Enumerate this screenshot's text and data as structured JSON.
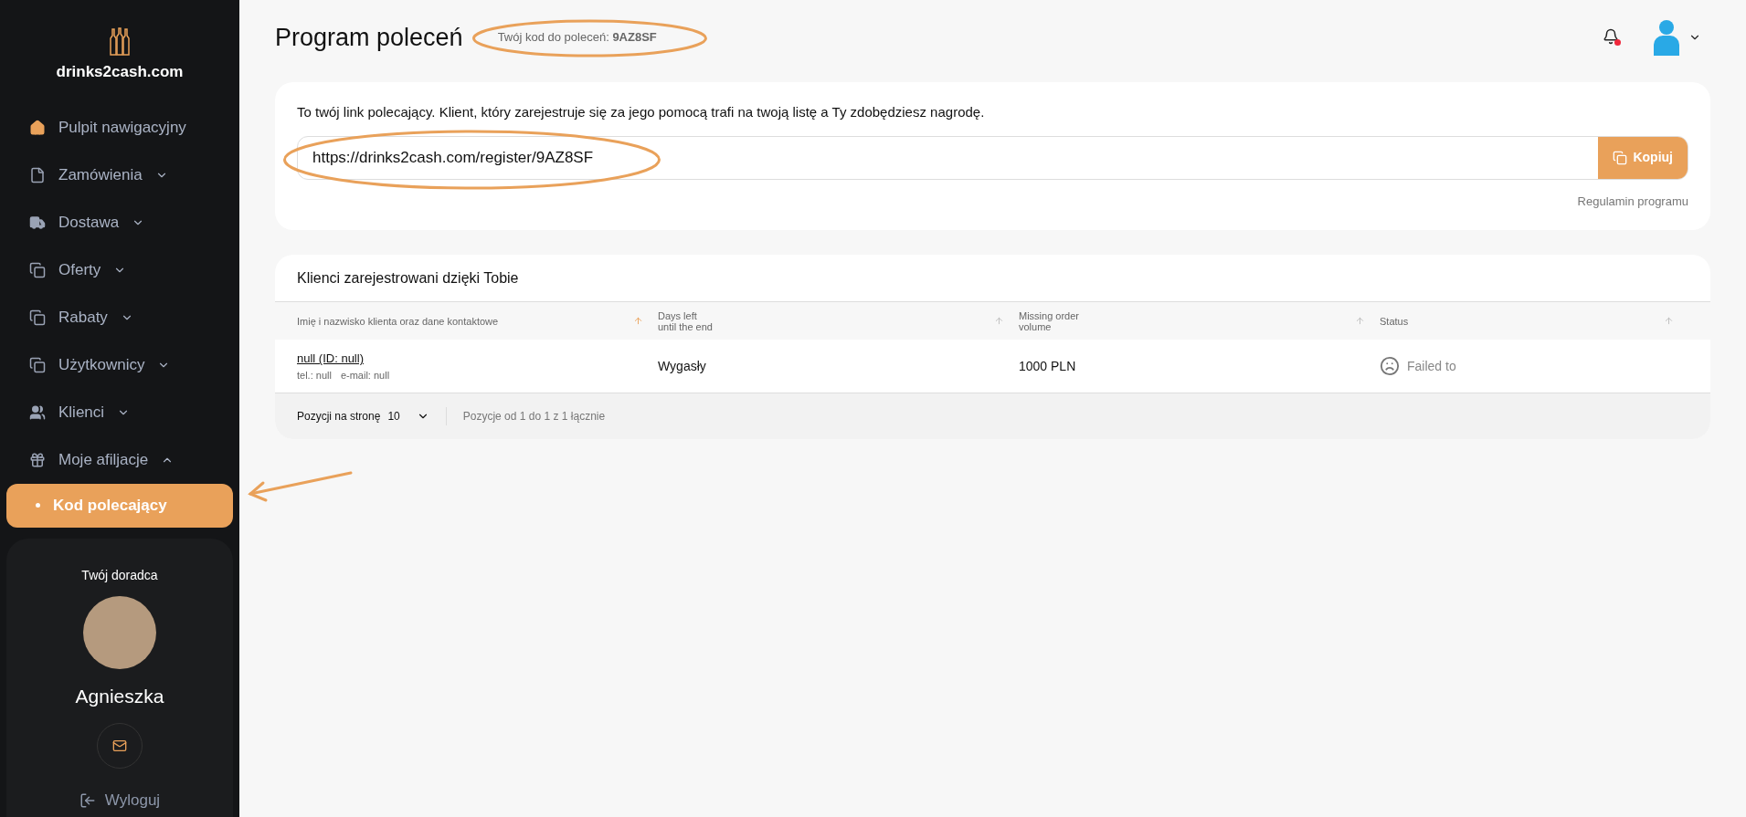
{
  "sidebar": {
    "logo": "drinks2cash.com",
    "items": [
      {
        "label": "Pulpit nawigacyjny",
        "kind": "link"
      },
      {
        "label": "Zamówienia",
        "kind": "menu",
        "expanded": false
      },
      {
        "label": "Dostawa",
        "kind": "menu",
        "expanded": false
      },
      {
        "label": "Oferty",
        "kind": "menu",
        "expanded": false
      },
      {
        "label": "Rabaty",
        "kind": "menu",
        "expanded": false
      },
      {
        "label": "Użytkownicy",
        "kind": "menu",
        "expanded": false
      },
      {
        "label": "Klienci",
        "kind": "menu",
        "expanded": false
      },
      {
        "label": "Moje afiljacje",
        "kind": "menu",
        "expanded": true,
        "children": [
          {
            "label": "Kod polecający",
            "selected": true
          }
        ]
      }
    ],
    "advisor": {
      "title": "Twój doradca",
      "name": "Agnieszka"
    },
    "logout": "Wyloguj"
  },
  "header": {
    "title": "Program poleceń",
    "code": "Twój kod do poleceń: **9AZ8SF**",
    "notification": true
  },
  "referral": {
    "description": "To twój link polecający. Klient, który zarejestruje się za jego pomocą trafi na twoją listę a Ty zdobędziesz nagrodę.",
    "url": "https://drinks2cash.com/register/9AZ8SF",
    "copy_button": "Kopiuj",
    "terms_link": "Regulamin programu"
  },
  "table": {
    "title": "Klienci zarejestrowani dzięki Tobie",
    "columns": [
      {
        "label": "Imię i nazwisko klienta oraz dane kontaktowe",
        "sorted": true
      },
      {
        "label": "Days left\nuntil the end",
        "sorted": false
      },
      {
        "label": "Missing order\nvolume",
        "sorted": false
      },
      {
        "label": "Status",
        "sorted": false
      }
    ],
    "rows": [
      {
        "name": "null (ID: null)",
        "phone": "tel.: null",
        "email": "e-mail: null",
        "days_left": "Wygasły",
        "missing_volume": "1000 PLN",
        "status": "Failed to"
      }
    ],
    "footer": {
      "per_page_label": "Pozycji na stronę",
      "per_page": "10",
      "range": "Pozycje od 1 do 1 z 1 łącznie"
    }
  }
}
